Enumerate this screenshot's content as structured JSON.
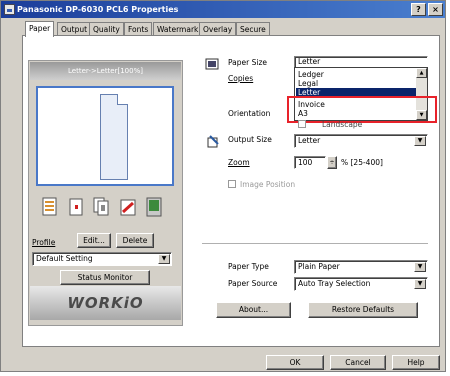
{
  "window": {
    "title": "Panasonic DP-6030 PCL6 Properties",
    "help_button": "?",
    "close_button": "×"
  },
  "tabs": [
    {
      "label": "Paper",
      "active": true
    },
    {
      "label": "Output",
      "active": false
    },
    {
      "label": "Quality",
      "active": false
    },
    {
      "label": "Fonts",
      "active": false
    },
    {
      "label": "Watermark",
      "active": false
    },
    {
      "label": "Overlay",
      "active": false
    },
    {
      "label": "Secure",
      "active": false
    }
  ],
  "preview": {
    "caption": "Letter->Letter[100%]",
    "icons": [
      "document-icon",
      "card-icon",
      "copies-icon",
      "finisher-icon",
      "tray-icon"
    ]
  },
  "profile": {
    "label": "Profile",
    "edit_button": "Edit...",
    "delete_button": "Delete",
    "selected": "Default Setting",
    "status_monitor_button": "Status Monitor"
  },
  "brand": {
    "logo_text": "WORKiO"
  },
  "paper_size": {
    "label": "Paper Size",
    "value": "Letter",
    "options": [
      {
        "label": "Ledger",
        "selected": false
      },
      {
        "label": "Legal",
        "selected": false
      },
      {
        "label": "Letter",
        "selected": true
      },
      {
        "label": "Invoice",
        "selected": false
      },
      {
        "label": "A3",
        "selected": false
      }
    ]
  },
  "copies": {
    "label": "Copies"
  },
  "orientation": {
    "label": "Orientation",
    "landscape_label": "Landscape"
  },
  "output_size": {
    "label": "Output Size",
    "value": "Letter"
  },
  "zoom": {
    "label": "Zoom",
    "value": "100",
    "range": "% [25-400]"
  },
  "image_position": {
    "label": "Image Position",
    "enabled": false
  },
  "paper_type": {
    "label": "Paper Type",
    "value": "Plain Paper"
  },
  "paper_source": {
    "label": "Paper Source",
    "value": "Auto Tray Selection"
  },
  "buttons": {
    "about": "About...",
    "restore_defaults": "Restore Defaults",
    "ok": "OK",
    "cancel": "Cancel",
    "help": "Help"
  },
  "colors": {
    "title_bar": "#1b3d9a",
    "selection": "#0a246a",
    "highlight_box": "#e8222a"
  }
}
